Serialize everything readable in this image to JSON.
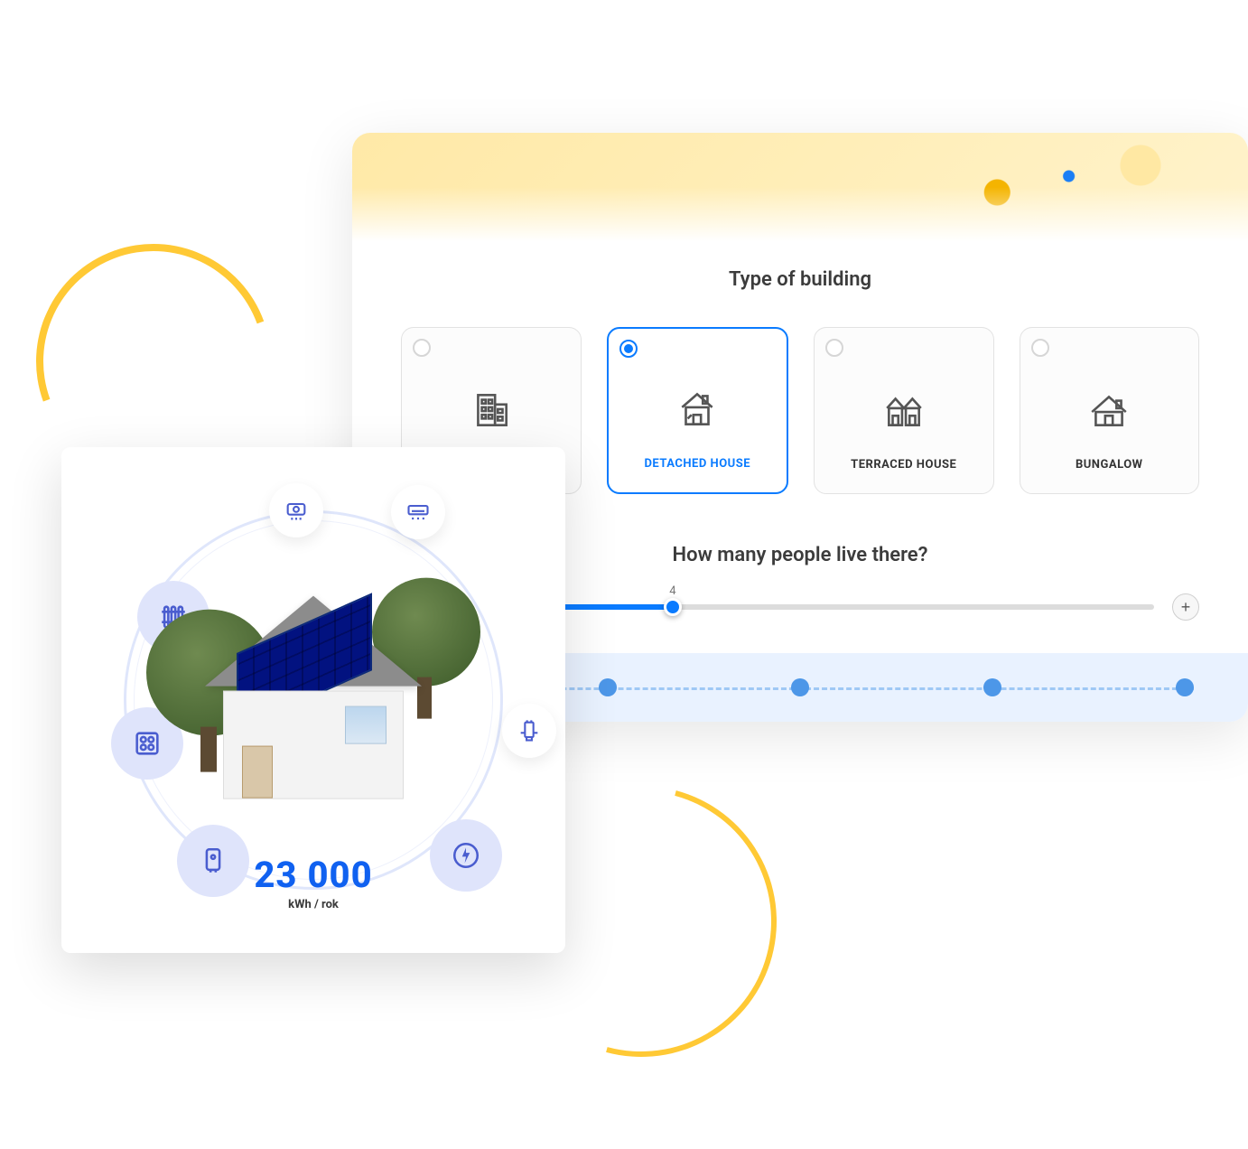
{
  "form": {
    "heading_building": "Type of building",
    "options": [
      {
        "label": "FLAT",
        "selected": false
      },
      {
        "label": "DETACHED HOUSE",
        "selected": true
      },
      {
        "label": "TERRACED HOUSE",
        "selected": false
      },
      {
        "label": "BUNGALOW",
        "selected": false
      }
    ],
    "heading_people": "How many people live there?",
    "slider": {
      "value": "4",
      "min": 1,
      "max": 10,
      "position_pct": 32
    },
    "progress_steps": 5
  },
  "energy": {
    "value": "23 000",
    "unit": "kWh / rok",
    "bubbles": [
      "heater-icon",
      "ac-icon",
      "radiator-icon",
      "stove-icon",
      "pump-icon",
      "boiler-icon",
      "power-icon"
    ]
  },
  "colors": {
    "accent": "#0a7bff",
    "yellow": "#ffd54a"
  }
}
